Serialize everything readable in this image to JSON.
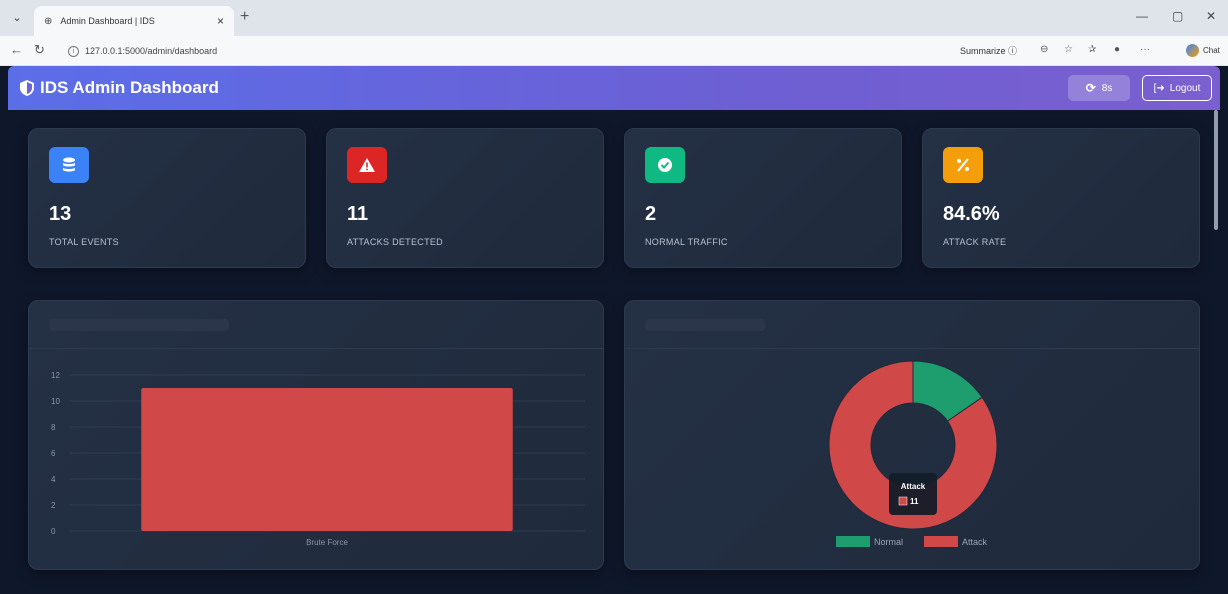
{
  "browser": {
    "tab_title": "Admin Dashboard | IDS",
    "tab_close": "×",
    "new_tab": "+",
    "url": "127.0.0.1:5000/admin/dashboard",
    "summarize": "Summarize",
    "chat": "Chat",
    "minimize": "—",
    "maximize": "▢",
    "close": "✕"
  },
  "navbar": {
    "title": "IDS Admin Dashboard",
    "refresh_label": "8s",
    "logout_label": "Logout"
  },
  "stats": [
    {
      "value": "13",
      "label": "TOTAL EVENTS",
      "color": "#3b82f6",
      "icon": "database-icon"
    },
    {
      "value": "11",
      "label": "ATTACKS DETECTED",
      "color": "#dc2626",
      "icon": "warning-icon"
    },
    {
      "value": "2",
      "label": "NORMAL TRAFFIC",
      "color": "#10b981",
      "icon": "check-circle-icon"
    },
    {
      "value": "84.6%",
      "label": "ATTACK RATE",
      "color": "#f59e0b",
      "icon": "percent-icon"
    }
  ],
  "chart_data": [
    {
      "type": "bar",
      "categories": [
        "Brute Force"
      ],
      "values": [
        11
      ],
      "ylim": [
        0,
        12
      ],
      "yticks": [
        0,
        2,
        4,
        6,
        8,
        10,
        12
      ],
      "ytick_labels": [
        "0",
        "2",
        "4",
        "6",
        "8",
        "10",
        "12"
      ],
      "bar_color": "#d04848",
      "grid": true
    },
    {
      "type": "pie",
      "donut": true,
      "labels": [
        "Normal",
        "Attack"
      ],
      "values": [
        2,
        11
      ],
      "colors": [
        "#1e9e6e",
        "#d04848"
      ],
      "legend_position": "bottom",
      "tooltip": {
        "title": "Attack",
        "value": "11"
      }
    }
  ]
}
